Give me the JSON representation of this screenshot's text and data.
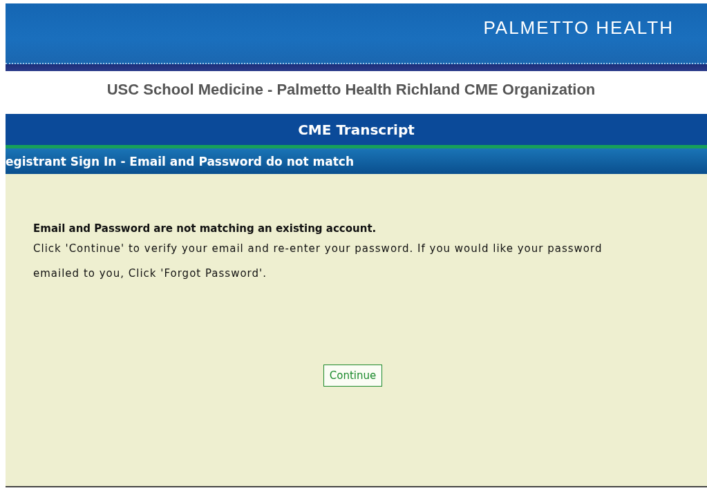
{
  "header": {
    "brand": "PALMETTO HEALTH"
  },
  "organization": "USC School Medicine - Palmetto Health Richland CME Organization",
  "page_title": "CME Transcript",
  "section_title": "egistrant Sign In - Email and Password do not match",
  "message": {
    "heading": "Email and Password are not matching an existing account.",
    "body": "Click 'Continue' to verify your email and re-enter your password. If you would like your password emailed to you, Click 'Forgot Password'."
  },
  "buttons": [
    {
      "label": "Continue"
    }
  ]
}
